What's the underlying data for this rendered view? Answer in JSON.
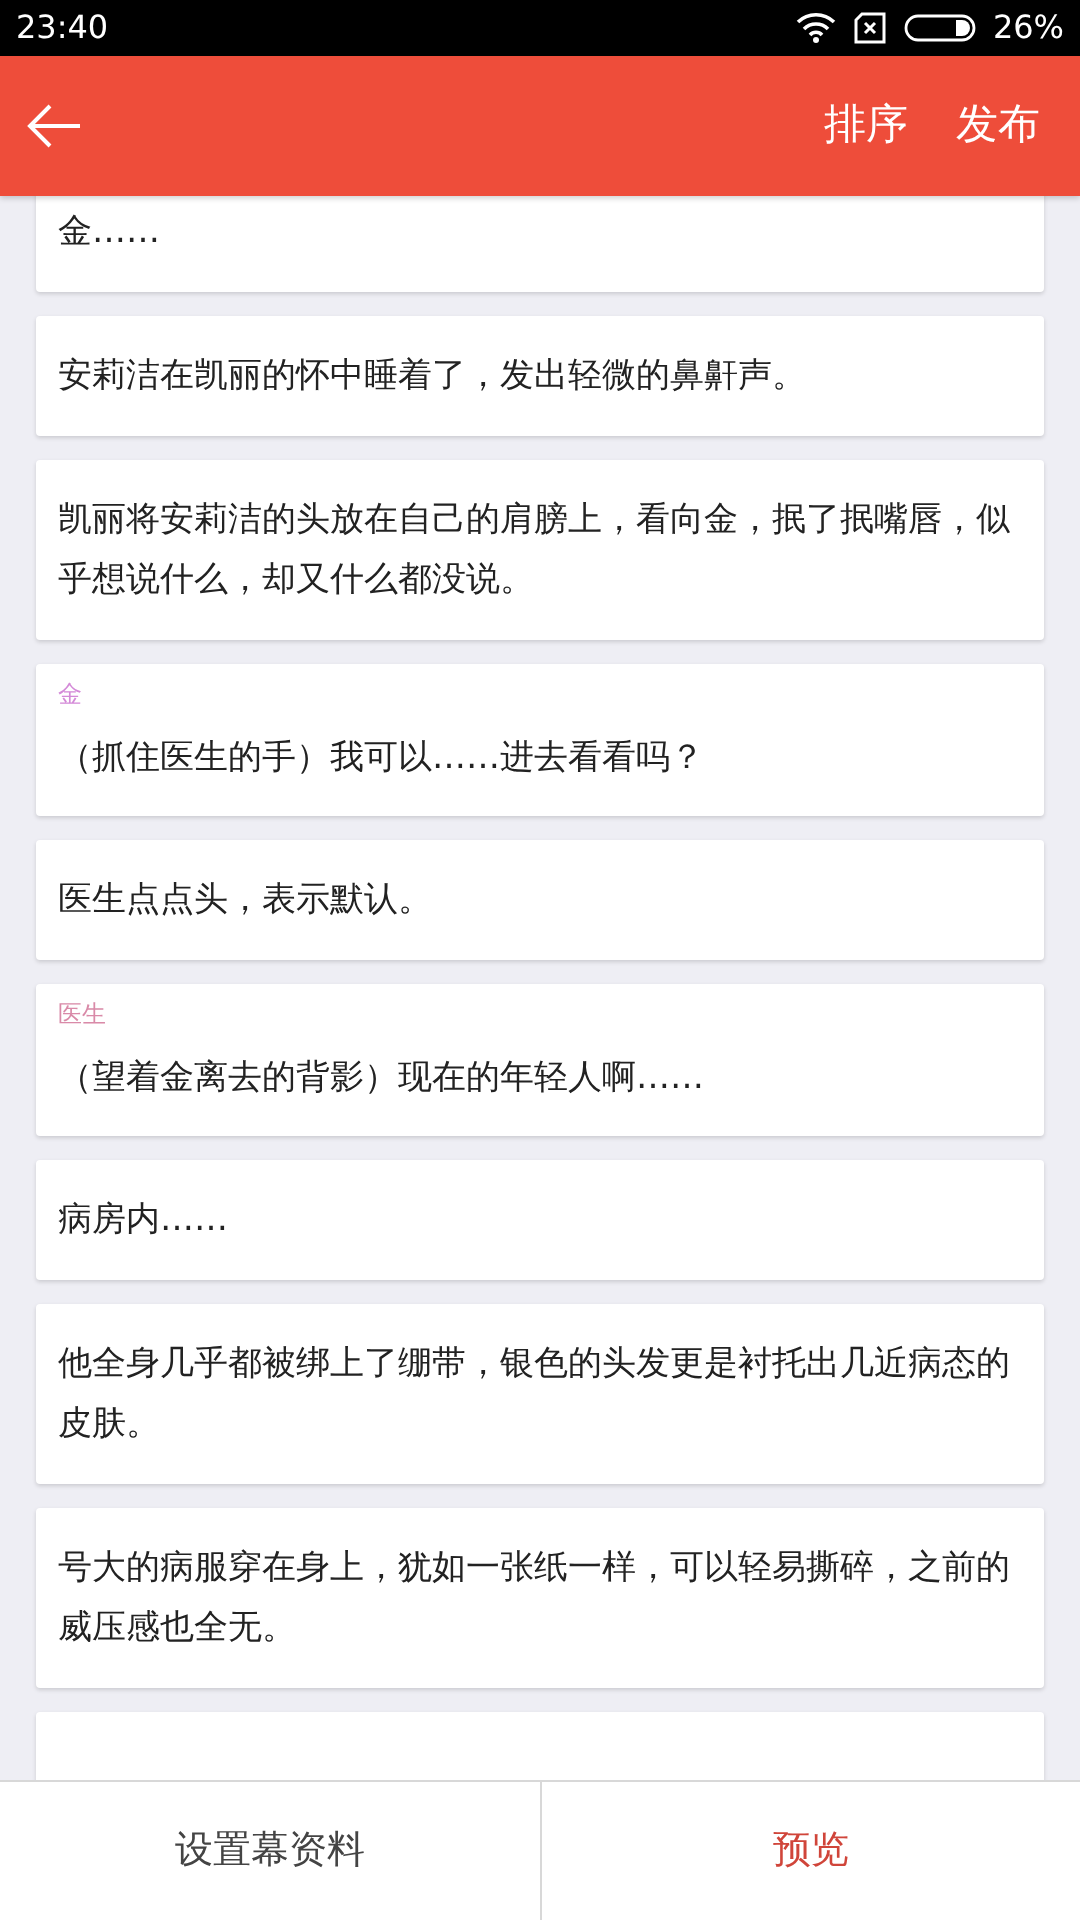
{
  "status_bar": {
    "time": "23:40",
    "battery": "26%"
  },
  "header": {
    "actions": [
      "排序",
      "发布"
    ]
  },
  "cards": [
    {
      "kind": "narration",
      "text": "金……"
    },
    {
      "kind": "narration",
      "text": "安莉洁在凯丽的怀中睡着了，发出轻微的鼻鼾声。"
    },
    {
      "kind": "narration",
      "text": "凯丽将安莉洁的头放在自己的肩膀上，看向金，抿了抿嘴唇，似乎想说什么，却又什么都没说。"
    },
    {
      "kind": "dialogue",
      "speaker": "金",
      "color": "#d48ad8",
      "text": "（抓住医生的手）我可以……进去看看吗？"
    },
    {
      "kind": "narration",
      "text": "医生点点头，表示默认。"
    },
    {
      "kind": "dialogue",
      "speaker": "医生",
      "color": "#d98aa8",
      "text": "（望着金离去的背影）现在的年轻人啊……"
    },
    {
      "kind": "narration",
      "text": "病房内……"
    },
    {
      "kind": "narration",
      "text": "他全身几乎都被绑上了绷带，银色的头发更是衬托出几近病态的皮肤。"
    },
    {
      "kind": "narration",
      "text": "号大的病服穿在身上，犹如一张纸一样，可以轻易撕碎，之前的威压感也全无。"
    },
    {
      "kind": "blank"
    }
  ],
  "bottom_bar": [
    {
      "label": "设置幕资料",
      "selected": false
    },
    {
      "label": "预览",
      "selected": true
    }
  ]
}
